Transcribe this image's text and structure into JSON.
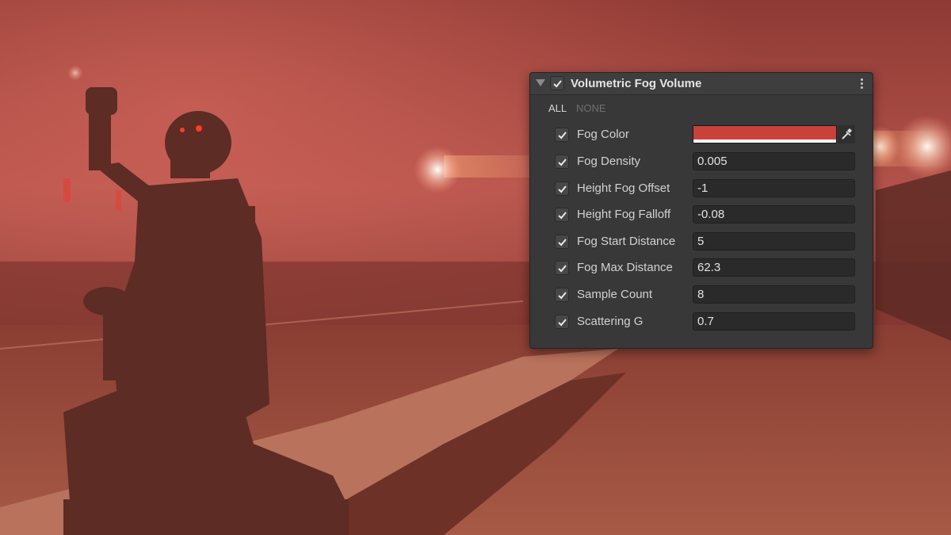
{
  "panel": {
    "title": "Volumetric Fog Volume",
    "filter_all": "ALL",
    "filter_none": "NONE",
    "menu_icon": "kebab-menu-icon",
    "foldout_icon": "triangle-down-icon",
    "check_icon": "checkmark-icon",
    "fog_color": {
      "label": "Fog Color",
      "value_hex": "#c8423a",
      "alpha_bar": "#ffffff",
      "picker_icon": "eyedropper-icon"
    },
    "properties": [
      {
        "label": "Fog Density",
        "value": "0.005"
      },
      {
        "label": "Height Fog Offset",
        "value": "-1"
      },
      {
        "label": "Height Fog Falloff",
        "value": "-0.08"
      },
      {
        "label": "Fog Start Distance",
        "value": "5"
      },
      {
        "label": "Fog Max Distance",
        "value": "62.3"
      },
      {
        "label": "Sample Count",
        "value": "8"
      },
      {
        "label": "Scattering G",
        "value": "0.7"
      }
    ]
  }
}
